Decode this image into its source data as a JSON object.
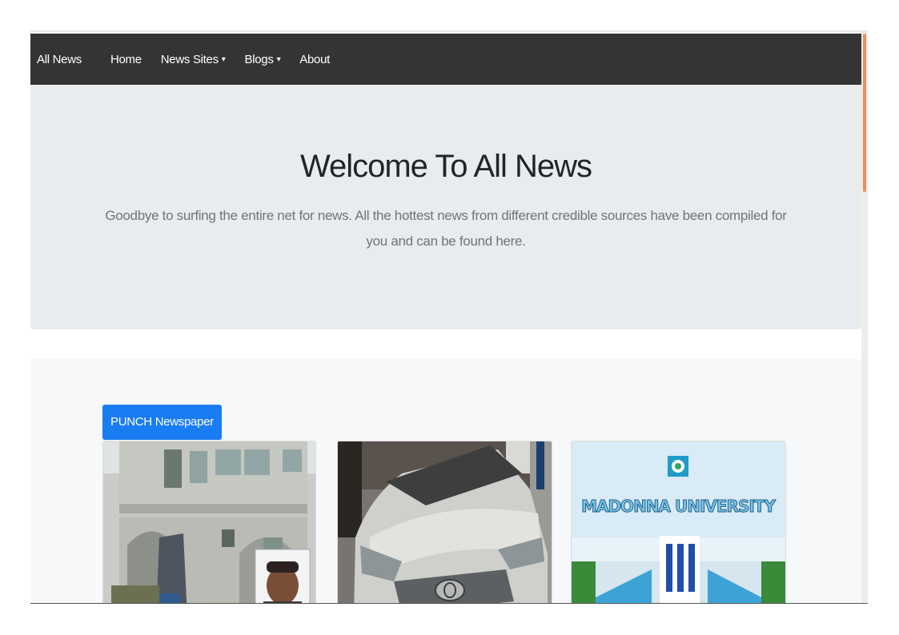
{
  "navbar": {
    "brand": "All News",
    "links": [
      {
        "label": "Home",
        "has_dropdown": false
      },
      {
        "label": "News Sites",
        "has_dropdown": true
      },
      {
        "label": "Blogs",
        "has_dropdown": true
      },
      {
        "label": "About",
        "has_dropdown": false
      }
    ],
    "caret_glyph": "▾"
  },
  "hero": {
    "title": "Welcome To All News",
    "lead": "Goodbye to surfing the entire net for news. All the hottest news from different credible sources have been compiled for you and can be found here."
  },
  "news": {
    "source_label": "PUNCH Newspaper",
    "cards": [
      {
        "image": "house-with-man-portrait"
      },
      {
        "image": "silver-toyota-car"
      },
      {
        "image": "madonna-university-gate",
        "image_text": "MADONNA UNIVERSITY"
      }
    ]
  },
  "colors": {
    "navbar_bg": "#343434",
    "hero_bg": "#e9ecef",
    "badge_bg": "#1a7cf2",
    "scroll_thumb": "#e8905f"
  }
}
